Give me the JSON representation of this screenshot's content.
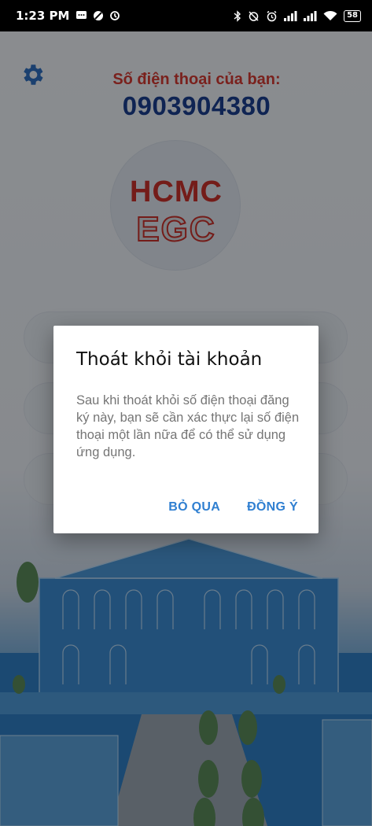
{
  "status_bar": {
    "time": "1:23 PM",
    "battery": "58",
    "left_icons": [
      "message-icon",
      "blocked-icon",
      "sync-icon"
    ],
    "right_icons": [
      "bluetooth-icon",
      "alarm-off-icon",
      "alarm-icon",
      "signal-icon",
      "signal-icon",
      "wifi-icon"
    ]
  },
  "header": {
    "phone_label": "Số điện thoại của bạn:",
    "phone_number": "0903904380"
  },
  "logo": {
    "line1": "HCMC",
    "line2": "EGC"
  },
  "dialog": {
    "title": "Thoát khỏi tài khoản",
    "message": "Sau khi thoát khỏi số điện thoại đăng ký này, bạn sẽ cần xác thực lại số điện thoại một lần nữa để có thể sử dụng ứng dụng.",
    "cancel_label": "BỎ QUA",
    "confirm_label": "ĐỒNG Ý"
  },
  "colors": {
    "accent": "#2f7fd1",
    "brand_red": "#c8312b",
    "brand_blue": "#1a3f8f"
  }
}
